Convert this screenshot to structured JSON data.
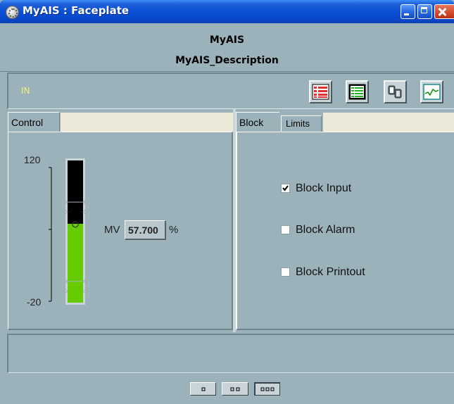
{
  "window": {
    "title": "MyAIS : Faceplate"
  },
  "header": {
    "tag_name": "MyAIS",
    "tag_description": "MyAIS_Description"
  },
  "status": {
    "text": "IN",
    "text_color": "#f0f07a"
  },
  "toolbar": {
    "buttons": [
      {
        "icon": "alarm-list-icon"
      },
      {
        "icon": "event-list-icon"
      },
      {
        "icon": "trend-config-icon"
      },
      {
        "icon": "trend-icon"
      }
    ]
  },
  "left_panel": {
    "tab_label": "Control",
    "scale": {
      "max_label": "120",
      "min_label": "-20",
      "max": 120,
      "min": -20
    },
    "bar": {
      "value_percent": 57.7,
      "fill_color": "#66cc00",
      "empty_color": "#000000",
      "upper_limit_marker": 79,
      "lower_limit_marker": 1
    },
    "mv": {
      "label": "MV",
      "value": "57.700",
      "unit": "%"
    }
  },
  "right_panel": {
    "tabs": [
      {
        "label": "Block",
        "active": true
      },
      {
        "label": "Limits",
        "active": false
      }
    ],
    "options": [
      {
        "label": "Block Input",
        "checked": true
      },
      {
        "label": "Block Alarm",
        "checked": false
      },
      {
        "label": "Block Printout",
        "checked": false
      }
    ]
  },
  "message_area": {
    "text": ""
  },
  "view_buttons": [
    {
      "icon": "small-view-icon",
      "selected": false
    },
    {
      "icon": "medium-view-icon",
      "selected": false
    },
    {
      "icon": "large-view-icon",
      "selected": true
    }
  ],
  "colors": {
    "background": "#9bb2bb",
    "title_bar": "#0a4ed4",
    "tab_strip": "#ece9d8"
  }
}
